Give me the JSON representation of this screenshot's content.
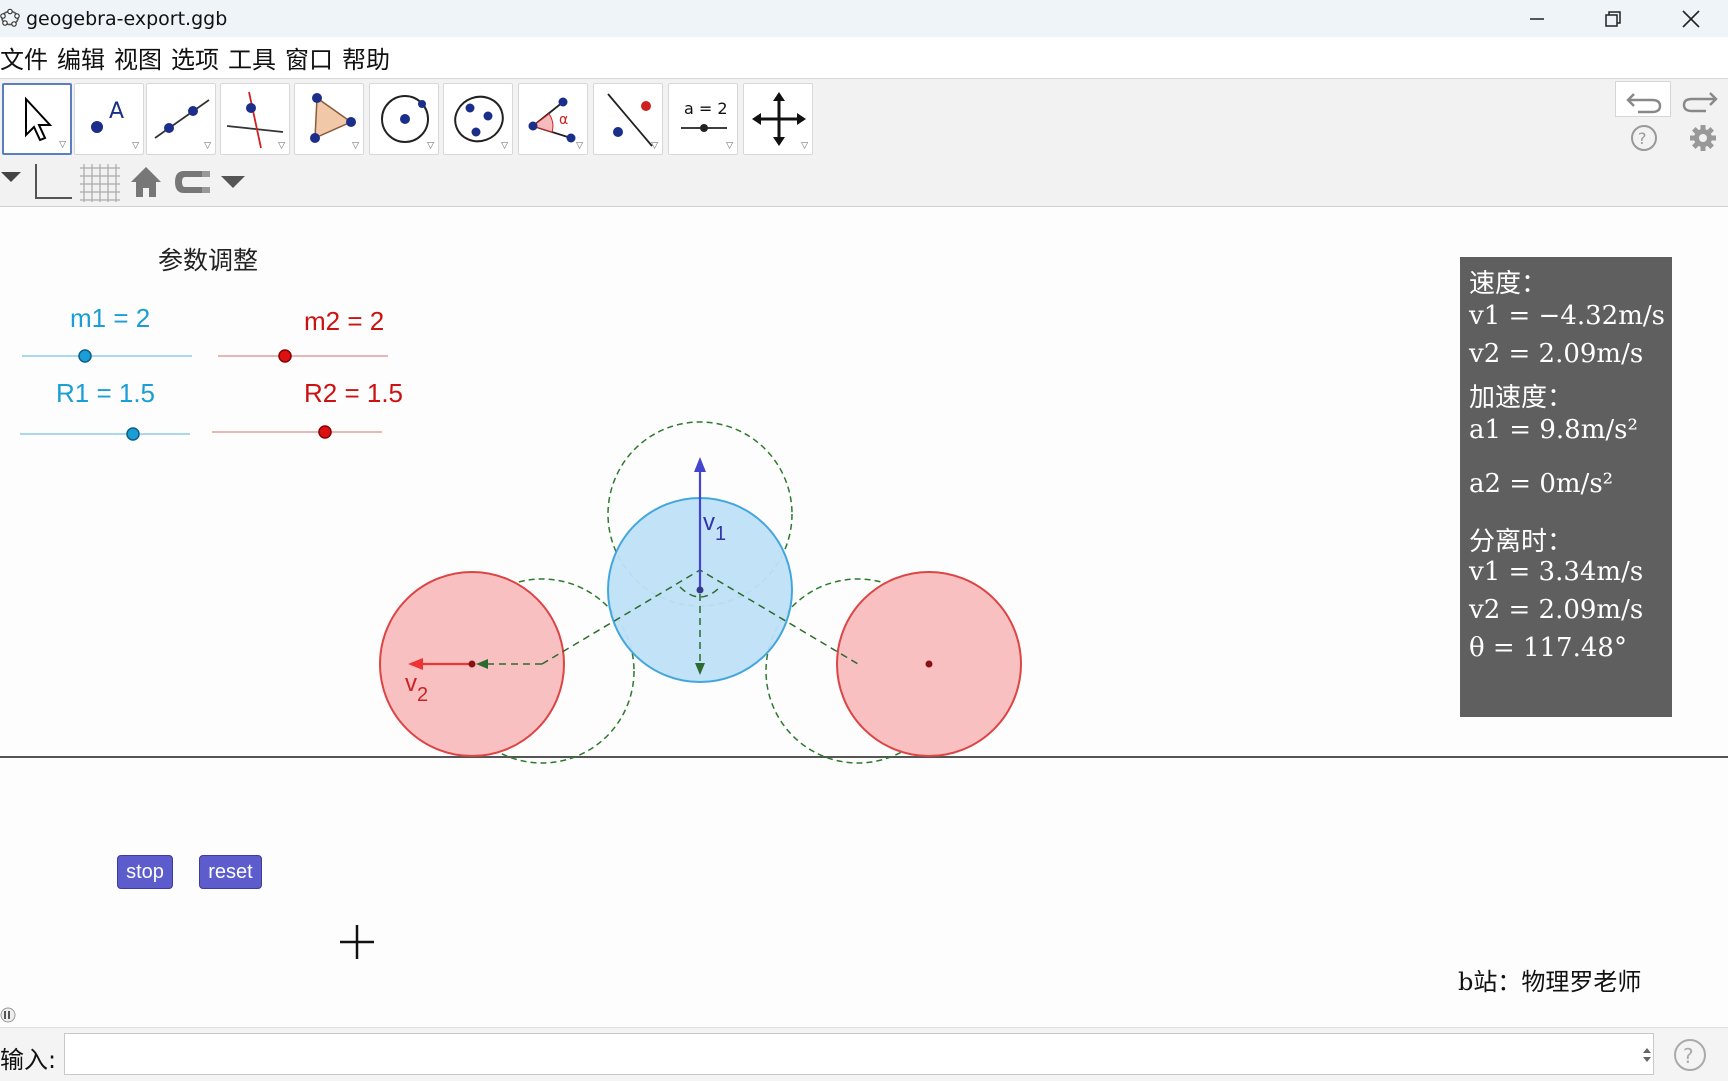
{
  "window": {
    "title": "geogebra-export.ggb"
  },
  "menu": {
    "items": [
      "文件",
      "编辑",
      "视图",
      "选项",
      "工具",
      "窗口",
      "帮助"
    ]
  },
  "toolbar": {
    "tools": [
      {
        "name": "move-tool",
        "icon": "arrow-pointer-icon"
      },
      {
        "name": "point-tool",
        "icon": "point-icon",
        "text": "A"
      },
      {
        "name": "line-tool",
        "icon": "line-through-points-icon"
      },
      {
        "name": "perpendicular-line-tool",
        "icon": "perpendicular-line-icon"
      },
      {
        "name": "polygon-tool",
        "icon": "polygon-icon"
      },
      {
        "name": "circle-tool",
        "icon": "circle-center-point-icon"
      },
      {
        "name": "ellipse-tool",
        "icon": "ellipse-icon"
      },
      {
        "name": "angle-tool",
        "icon": "angle-icon",
        "text": "α"
      },
      {
        "name": "reflect-tool",
        "icon": "reflect-about-line-icon"
      },
      {
        "name": "slider-tool",
        "icon": "slider-icon",
        "text": "a = 2"
      },
      {
        "name": "move-graphics-tool",
        "icon": "move-graphics-icon"
      }
    ]
  },
  "sliders": {
    "heading": "参数调整",
    "m1": {
      "label": "m1 = 2",
      "value": 2,
      "color": "#1a9ed6"
    },
    "m2": {
      "label": "m2 = 2",
      "value": 2,
      "color": "#cc1111"
    },
    "R1": {
      "label": "R1 = 1.5",
      "value": 1.5,
      "color": "#1a9ed6"
    },
    "R2": {
      "label": "R2 = 1.5",
      "value": 1.5,
      "color": "#cc1111"
    }
  },
  "vectors": {
    "v1": "v",
    "v1_sub": "1",
    "v2": "v",
    "v2_sub": "2"
  },
  "info": {
    "speed_heading": "速度：",
    "v1_speed": "v1 = −4.32m/s",
    "v2_speed": "v2 = 2.09m/s",
    "accel_heading": "加速度：",
    "a1": "a1 = 9.8m/s²",
    "a2": "a2 = 0m/s²",
    "separation_heading": "分离时：",
    "v1_sep": "v1 = 3.34m/s",
    "v2_sep": "v2 = 2.09m/s",
    "theta": "θ = 117.48°"
  },
  "buttons": {
    "stop": "stop",
    "reset": "reset"
  },
  "credit": "b站：物理罗老师",
  "input": {
    "label": "输入:",
    "value": ""
  },
  "colors": {
    "blue_ball": "#bfe2f7",
    "blue_stroke": "#3aa3dc",
    "red_ball": "#f8c0c0",
    "red_stroke": "#dd4444",
    "button": "#5c5ccc",
    "info_bg": "#5f5f5f"
  }
}
